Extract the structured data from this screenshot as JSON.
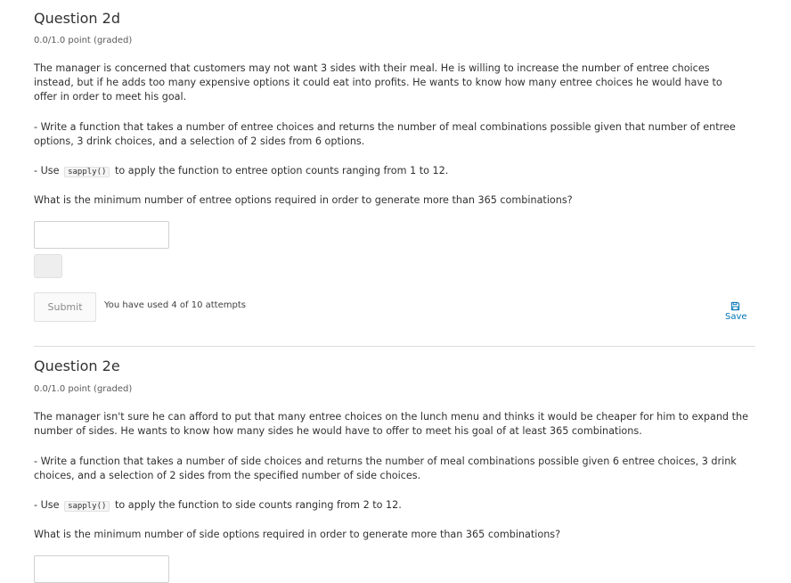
{
  "question_2d": {
    "title": "Question 2d",
    "status": "0.0/1.0 point (graded)",
    "intro": "The manager is concerned that customers may not want 3 sides with their meal. He is willing to increase the number of entree choices instead, but if he adds too many expensive options it could eat into profits. He wants to know how many entree choices he would have to offer in order to meet his goal.",
    "task1": "- Write a function that takes a number of entree choices and returns the number of meal combinations possible given that number of entree options, 3 drink choices, and a selection of 2 sides from 6 options.",
    "task2_prefix": "- Use",
    "task2_code": "sapply()",
    "task2_suffix": "to apply the function to entree option counts ranging from 1 to 12.",
    "question": "What is the minimum number of entree options required in order to generate more than 365 combinations?",
    "answer_value": "",
    "submit_label": "Submit",
    "attempts_text": "You have used 4 of 10 attempts",
    "save_label": "Save"
  },
  "question_2e": {
    "title": "Question 2e",
    "status": "0.0/1.0 point (graded)",
    "intro": "The manager isn't sure he can afford to put that many entree choices on the lunch menu and thinks it would be cheaper for him to expand the number of sides. He wants to know how many sides he would have to offer to meet his goal of at least 365 combinations.",
    "task1": "- Write a function that takes a number of side choices and returns the number of meal combinations possible given 6 entree choices, 3 drink choices, and a selection of 2 sides from the specified number of side choices.",
    "task2_prefix": "- Use",
    "task2_code": "sapply()",
    "task2_suffix": "to apply the function to side counts ranging from 2 to 12.",
    "question": "What is the minimum number of side options required in order to generate more than 365 combinations?",
    "answer_value": ""
  },
  "icons": {
    "save": "floppy-disk-icon"
  },
  "colors": {
    "link": "#0075b4",
    "text": "#313131",
    "divider": "#dddddd"
  }
}
